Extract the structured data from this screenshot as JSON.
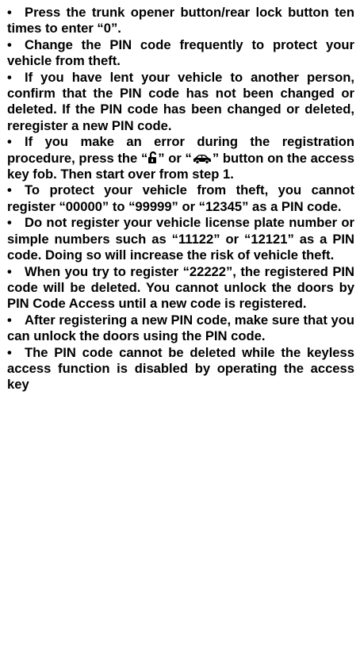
{
  "notes": [
    {
      "bullet": "•",
      "text": "Press the trunk opener button/rear lock button ten times to enter “0”."
    },
    {
      "bullet": "•",
      "text": "Change the PIN code frequently to protect your vehicle from theft."
    },
    {
      "bullet": "•",
      "text": "If you have lent your vehicle to another person, confirm that the PIN code has not been changed or deleted. If the PIN code has been changed or deleted, reregister a new PIN code."
    },
    {
      "bullet": "•",
      "text_before": "If you make an error during the registration procedure, press the “",
      "text_between": "” or “",
      "text_after": "” button on the access key fob. Then start over from step 1.",
      "icons": [
        "trunk-open-icon",
        "car-icon"
      ]
    },
    {
      "bullet": "•",
      "text": "To protect your vehicle from theft, you cannot register “00000” to “99999” or “12345” as a PIN code."
    },
    {
      "bullet": "•",
      "text": "Do not register your vehicle license plate number or simple numbers such as “11122” or “12121” as a PIN code. Doing so will increase the risk of vehicle theft."
    },
    {
      "bullet": "•",
      "text": "When you try to register “22222”, the registered PIN code will be deleted. You cannot unlock the doors by PIN Code Access until a new code is registered."
    },
    {
      "bullet": "•",
      "text": "After registering a new PIN code, make sure that you can unlock the doors using the PIN code."
    },
    {
      "bullet": "•",
      "text": "The PIN code cannot be deleted while the keyless access function is disabled by operating the access key"
    }
  ]
}
